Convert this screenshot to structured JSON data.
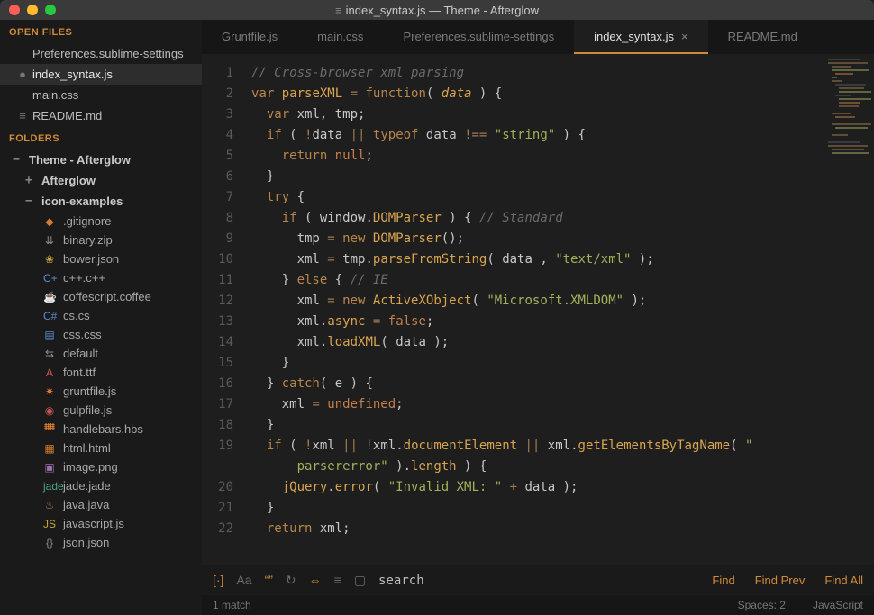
{
  "titlebar": {
    "title": "index_syntax.js — Theme - Afterglow"
  },
  "sidebar": {
    "open_files_header": "OPEN FILES",
    "open_files": [
      {
        "name": "Preferences.sublime-settings",
        "active": false,
        "dirty": false
      },
      {
        "name": "index_syntax.js",
        "active": true,
        "dirty": true
      },
      {
        "name": "main.css",
        "active": false,
        "dirty": false
      },
      {
        "name": "README.md",
        "active": false,
        "dirty": false
      }
    ],
    "folders_header": "FOLDERS",
    "root": {
      "name": "Theme - Afterglow",
      "expander": "−"
    },
    "sub1": {
      "name": "Afterglow",
      "expander": "+"
    },
    "sub2": {
      "name": "icon-examples",
      "expander": "−"
    },
    "files": [
      {
        "name": ".gitignore",
        "glyph": "◆",
        "cls": "ic-orange"
      },
      {
        "name": "binary.zip",
        "glyph": "⇊",
        "cls": "ic-gray"
      },
      {
        "name": "bower.json",
        "glyph": "❀",
        "cls": "ic-yellow"
      },
      {
        "name": "c++.c++",
        "glyph": "C+",
        "cls": "ic-blue"
      },
      {
        "name": "coffescript.coffee",
        "glyph": "☕",
        "cls": "ic-brown"
      },
      {
        "name": "cs.cs",
        "glyph": "C#",
        "cls": "ic-blue"
      },
      {
        "name": "css.css",
        "glyph": "▤",
        "cls": "ic-blue"
      },
      {
        "name": "default",
        "glyph": "⇆",
        "cls": "ic-gray"
      },
      {
        "name": "font.ttf",
        "glyph": "A",
        "cls": "ic-red"
      },
      {
        "name": "gruntfile.js",
        "glyph": "✷",
        "cls": "ic-orange"
      },
      {
        "name": "gulpfile.js",
        "glyph": "◉",
        "cls": "ic-red"
      },
      {
        "name": "handlebars.hbs",
        "glyph": "ᚙ",
        "cls": "ic-orange"
      },
      {
        "name": "html.html",
        "glyph": "▦",
        "cls": "ic-orange"
      },
      {
        "name": "image.png",
        "glyph": "▣",
        "cls": "ic-purple"
      },
      {
        "name": "jade.jade",
        "glyph": "jade",
        "cls": "ic-teal"
      },
      {
        "name": "java.java",
        "glyph": "♨",
        "cls": "ic-brown"
      },
      {
        "name": "javascript.js",
        "glyph": "JS",
        "cls": "ic-yellow"
      },
      {
        "name": "json.json",
        "glyph": "{}",
        "cls": "ic-gray"
      }
    ]
  },
  "tabs": [
    {
      "label": "Gruntfile.js",
      "active": false
    },
    {
      "label": "main.css",
      "active": false
    },
    {
      "label": "Preferences.sublime-settings",
      "active": false
    },
    {
      "label": "index_syntax.js",
      "active": true
    },
    {
      "label": "README.md",
      "active": false
    }
  ],
  "code": {
    "lines": 22,
    "l1": {
      "c1": "// Cross-browser xml parsing"
    },
    "l2": {
      "kw": "var",
      "fn": "parseXML",
      "op": " = ",
      "kw2": "function",
      "open": "( ",
      "param": "data",
      "close": " ) {"
    },
    "l3": {
      "kw": "var",
      "rest": " xml, tmp;"
    },
    "l4": {
      "kw": "if",
      "open": " ( ",
      "op1": "!",
      "v1": "data ",
      "op2": "|| ",
      "kw2": "typeof",
      "v2": " data ",
      "op3": "!==",
      "str": " \"string\"",
      "close": " ) {"
    },
    "l5": {
      "kw": "return",
      "val": " null",
      "semi": ";"
    },
    "l6": {
      "brace": "}"
    },
    "l7": {
      "kw": "try",
      "brace": " {"
    },
    "l8": {
      "kw": "if",
      "open": " ( ",
      "obj": "window",
      "dot": ".",
      "prop": "DOMParser",
      "close": " ) { ",
      "com": "// Standard"
    },
    "l9": {
      "v": "tmp ",
      "op": "= ",
      "kw": "new",
      "sp": " ",
      "fn": "DOMParser",
      "paren": "();"
    },
    "l10": {
      "v": "xml ",
      "op": "= ",
      "v2": "tmp",
      "dot": ".",
      "fn": "parseFromString",
      "open": "( ",
      "p1": "data ",
      "comma": ", ",
      "str": "\"text/xml\"",
      "close": " );"
    },
    "l11": {
      "brace": "} ",
      "kw": "else",
      "brace2": " { ",
      "com": "// IE"
    },
    "l12": {
      "v": "xml ",
      "op": "= ",
      "kw": "new",
      "sp": " ",
      "fn": "ActiveXObject",
      "open": "( ",
      "str": "\"Microsoft.XMLDOM\"",
      "close": " );"
    },
    "l13": {
      "v": "xml",
      "dot": ".",
      "prop": "async",
      "op": " = ",
      "val": "false",
      "semi": ";"
    },
    "l14": {
      "v": "xml",
      "dot": ".",
      "fn": "loadXML",
      "open": "( ",
      "p1": "data",
      "close": " );"
    },
    "l15": {
      "brace": "}"
    },
    "l16": {
      "brace": "} ",
      "kw": "catch",
      "open": "( ",
      "p": "e",
      "close": " ) {"
    },
    "l17": {
      "v": "xml ",
      "op": "= ",
      "val": "undefined",
      "semi": ";"
    },
    "l18": {
      "brace": "}"
    },
    "l19": {
      "kw": "if",
      "open": " ( ",
      "op1": "!",
      "v1": "xml ",
      "op2": "|| ",
      "op3": "!",
      "v2": "xml",
      "dot": ".",
      "prop": "documentElement",
      "op4": " || ",
      "v3": "xml",
      "dot2": ".",
      "fn": "getElementsByTagName",
      "open2": "( ",
      "quote": "\""
    },
    "l19b": {
      "str": "parsererror\"",
      "close": " )",
      "dot": ".",
      "prop": "length",
      "close2": " ) {"
    },
    "l20": {
      "obj": "jQuery",
      "dot": ".",
      "fn": "error",
      "open": "( ",
      "str": "\"Invalid XML: \"",
      "op": " + ",
      "v": "data",
      "close": " );"
    },
    "l21": {
      "brace": "}"
    },
    "l22": {
      "kw": "return",
      "v": " xml;"
    }
  },
  "search": {
    "placeholder": "search",
    "find": "Find",
    "find_prev": "Find Prev",
    "find_all": "Find All"
  },
  "status": {
    "left": "1 match",
    "spaces": "Spaces: 2",
    "lang": "JavaScript"
  }
}
